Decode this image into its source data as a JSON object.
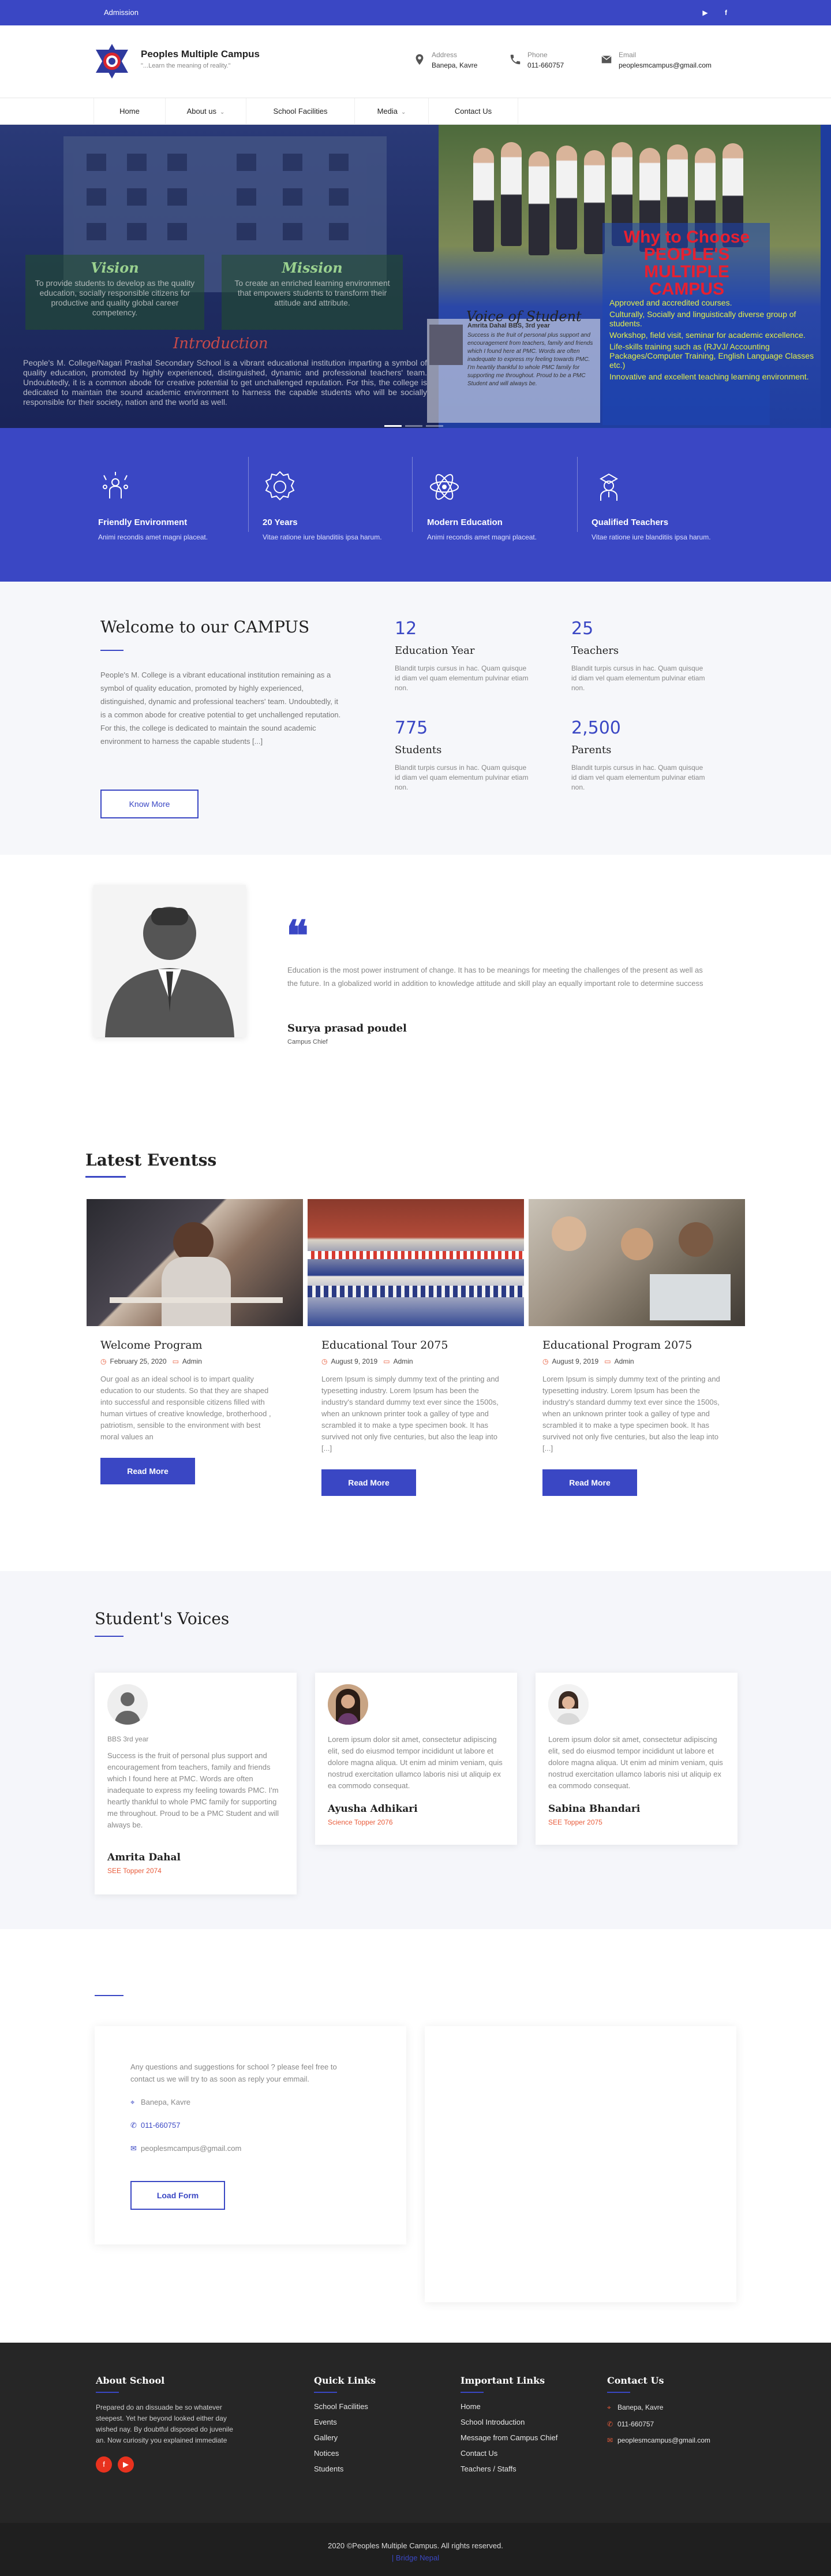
{
  "topbar": {
    "admission": "Admission",
    "social": [
      {
        "icon": "youtube-icon",
        "glyph": "▶"
      },
      {
        "icon": "facebook-icon",
        "glyph": "f"
      }
    ]
  },
  "header": {
    "name": "Peoples Multiple Campus",
    "tagline": "\"...Learn the meaning of reality.\"",
    "address_label": "Address",
    "address_value": "Banepa, Kavre",
    "phone_label": "Phone",
    "phone_value": "011-660757",
    "email_label": "Email",
    "email_value": "peoplesmcampus@gmail.com"
  },
  "nav": [
    {
      "label": "Home",
      "chevron": ""
    },
    {
      "label": "About us",
      "chevron": "⌄"
    },
    {
      "label": "School Facilities",
      "chevron": ""
    },
    {
      "label": "Media",
      "chevron": "⌄"
    },
    {
      "label": "Contact Us",
      "chevron": ""
    }
  ],
  "hero": {
    "vision_title": "Vision",
    "vision_text": "To provide students to develop as the quality education, socially responsible citizens for productive and quality global career competency.",
    "mission_title": "Mission",
    "mission_text": "To create an enriched learning environment that empowers students to transform their attitude and attribute.",
    "intro_title": "Introduction",
    "intro_text": "People's M. College/Nagari Prashal Secondary School is a vibrant educational institution imparting a symbol of quality education, promoted by highly experienced, distinguished, dynamic and professional teachers' team. Undoubtedly, it is a common abode for creative potential to get unchallenged reputation. For this, the college is dedicated to maintain the sound academic environment to harness the capable students who will be socially responsible for their society, nation and the world as well.",
    "voice_title": "Voice of Student",
    "voice_name": "Amrita Dahal BBS, 3rd year",
    "voice_text": "Success is the fruit of personal plus support and encouragement from teachers, family and friends which I found here at PMC. Words are often inadequate to express my feeling towards PMC. I'm heartily thankful to whole PMC family for supporting me throughout. Proud to be a PMC Student and will always be.",
    "why_title": "Why to Choose PEOPLE'S MULTIPLE CAMPUS",
    "why_list": [
      "Approved and accredited courses.",
      "Culturally, Socially and linguistically diverse group of students.",
      "Workshop, field visit, seminar for academic excellence.",
      "Life-skills training such as (RJVJ/ Accounting Packages/Computer Training, English Language Classes etc.)",
      "Innovative and excellent teaching learning environment."
    ]
  },
  "features": [
    {
      "icon": "friendly-environment-icon",
      "title": "Friendly Environment",
      "desc": "Animi recondis amet magni placeat."
    },
    {
      "icon": "years-badge-icon",
      "title": "20 Years",
      "desc": "Vitae ratione iure blanditiis ipsa harum."
    },
    {
      "icon": "atom-icon",
      "title": "Modern Education",
      "desc": "Animi recondis amet magni placeat."
    },
    {
      "icon": "teacher-icon",
      "title": "Qualified Teachers",
      "desc": "Vitae ratione iure blanditiis ipsa harum."
    }
  ],
  "welcome": {
    "title": "Welcome to our CAMPUS",
    "text": "People's M. College is a vibrant educational institution remaining as a symbol of quality education, promoted by highly experienced, distinguished, dynamic and professional teachers' team. Undoubtedly, it is a common abode for creative potential to get unchallenged reputation. For this, the college is dedicated to maintain the sound academic environment to harness the capable students [...]",
    "button": "Know More",
    "stats": [
      {
        "num": "12",
        "label": "Education Year",
        "desc": "Blandit turpis cursus in hac. Quam quisque id diam vel quam elementum pulvinar etiam non."
      },
      {
        "num": "25",
        "label": "Teachers",
        "desc": "Blandit turpis cursus in hac. Quam quisque id diam vel quam elementum pulvinar etiam non."
      },
      {
        "num": "775",
        "label": "Students",
        "desc": "Blandit turpis cursus in hac. Quam quisque id diam vel quam elementum pulvinar etiam non."
      },
      {
        "num": "2,500",
        "label": "Parents",
        "desc": "Blandit turpis cursus in hac. Quam quisque id diam vel quam elementum pulvinar etiam non."
      }
    ]
  },
  "quote": {
    "mark": "❝",
    "text": "Education is the most power instrument of change. It has to be meanings for meeting the challenges of the present as well as the future. In a globalized world in addition to knowledge attitude and skill play an equally important role to determine success",
    "name": "Surya prasad poudel",
    "role": "Campus Chief"
  },
  "events": {
    "title": "Latest Eventss",
    "items": [
      {
        "title": "Welcome Program",
        "date": "February 25, 2020",
        "author": "Admin",
        "text": "Our goal as an ideal school is to impart quality education to our students. So that they are shaped into successful and responsible citizens filled with human virtues of creative knowledge, brotherhood , patriotism, sensible to the environment with best moral values an",
        "button": "Read More"
      },
      {
        "title": "Educational Tour 2075",
        "date": "August 9, 2019",
        "author": "Admin",
        "text": "Lorem Ipsum is simply dummy text of the printing and typesetting industry. Lorem Ipsum has been the industry's standard dummy text ever since the 1500s, when an unknown printer took a galley of type and scrambled it to make a type specimen book. It has survived not only five centuries, but also the leap into [...]",
        "button": "Read More"
      },
      {
        "title": "Educational Program 2075",
        "date": "August 9, 2019",
        "author": "Admin",
        "text": "Lorem Ipsum is simply dummy text of the printing and typesetting industry. Lorem Ipsum has been the industry's standard dummy text ever since the 1500s, when an unknown printer took a galley of type and scrambled it to make a type specimen book. It has survived not only five centuries, but also the leap into [...]",
        "button": "Read More"
      }
    ]
  },
  "voices": {
    "title": "Student's Voices",
    "items": [
      {
        "subtitle": "BBS 3rd year",
        "text": "Success is the fruit of personal plus support and encouragement from teachers, family and friends which I found here at PMC. Words are often inadequate to express my feeling towards PMC. I'm heartly thankful to whole PMC family for supporting me throughout. Proud to be a PMC Student and will always be.",
        "name": "Amrita Dahal",
        "role": "SEE Topper 2074"
      },
      {
        "subtitle": "",
        "text": "Lorem ipsum dolor sit amet, consectetur adipiscing elit, sed do eiusmod tempor incididunt ut labore et dolore magna aliqua. Ut enim ad minim veniam, quis nostrud exercitation ullamco laboris nisi ut aliquip ex ea commodo consequat.",
        "name": "Ayusha Adhikari",
        "role": "Science Topper 2076"
      },
      {
        "subtitle": "",
        "text": "Lorem ipsum dolor sit amet, consectetur adipiscing elit, sed do eiusmod tempor incididunt ut labore et dolore magna aliqua. Ut enim ad minim veniam, quis nostrud exercitation ullamco laboris nisi ut aliquip ex ea commodo consequat.",
        "name": "Sabina Bhandari",
        "role": "SEE Topper 2075"
      }
    ]
  },
  "contact": {
    "intro": "Any questions and suggestions for school ? please feel free to contact us we will try to as soon as reply your emmail.",
    "address": "Banepa, Kavre",
    "phone": "011-660757",
    "email": "peoplesmcampus@gmail.com",
    "button": "Load Form"
  },
  "footer": {
    "about_title": "About School",
    "about_text": "Prepared do an dissuade be so whatever steepest. Yet her beyond looked either day wished nay. By doubtful disposed do juvenile an. Now curiosity you explained immediate",
    "quick_title": "Quick Links",
    "quick_links": [
      "School Facilities",
      "Events",
      "Gallery",
      "Notices",
      "Students"
    ],
    "important_title": "Important Links",
    "important_links": [
      "Home",
      "School Introduction",
      "Message from Campus Chief",
      "Contact Us",
      "Teachers / Staffs"
    ],
    "contact_title": "Contact Us",
    "contact_address": "Banepa, Kavre",
    "contact_phone": "011-660757",
    "contact_email": "peoplesmcampus@gmail.com",
    "copyright": "2020 ©Peoples Multiple Campus. All rights reserved.",
    "credit": "| Bridge Nepal"
  },
  "colors": {
    "primary": "#3a47c4",
    "accent": "#e85c3b",
    "footer_bg": "#262626"
  }
}
